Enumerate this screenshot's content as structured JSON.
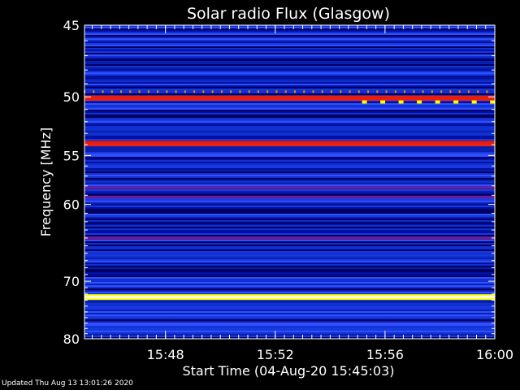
{
  "chart_data": {
    "type": "heatmap",
    "title": "Solar radio Flux (Glasgow)",
    "xlabel": "Start Time (04-Aug-20 15:45:03)",
    "ylabel": "Frequency [MHz]",
    "x_range": [
      "15:45:03",
      "16:00"
    ],
    "x_ticks": [
      "15:48",
      "15:52",
      "15:56",
      "16:00"
    ],
    "y_range": [
      45,
      80
    ],
    "y_ticks": [
      45,
      50,
      55,
      60,
      70,
      80
    ],
    "y_scale": "reciprocal",
    "grid": false,
    "colormap": [
      "#000060",
      "#0010a0",
      "#1030d0",
      "#3050ff",
      "#c00020",
      "#ff2000",
      "#ffff00",
      "#ffffff"
    ],
    "features": [
      {
        "kind": "continuous_band",
        "frequency_mhz": 50.1,
        "width_mhz": 0.4,
        "intensity": "red"
      },
      {
        "kind": "periodic_bursts",
        "frequency_mhz": 49.6,
        "period_s": 20,
        "intensity": "orange"
      },
      {
        "kind": "periodic_bursts",
        "frequency_mhz": 50.4,
        "start_time": "15:55:15",
        "period_s": 40,
        "intensity": "yellow"
      },
      {
        "kind": "continuous_band",
        "frequency_mhz": 53.9,
        "width_mhz": 0.5,
        "intensity": "red"
      },
      {
        "kind": "continuous_band",
        "frequency_mhz": 58.2,
        "width_mhz": 0.3,
        "intensity": "purple"
      },
      {
        "kind": "continuous_band",
        "frequency_mhz": 59.2,
        "width_mhz": 0.3,
        "intensity": "purple"
      },
      {
        "kind": "continuous_band",
        "frequency_mhz": 64.0,
        "width_mhz": 0.4,
        "intensity": "purple"
      },
      {
        "kind": "continuous_band",
        "frequency_mhz": 72.5,
        "width_mhz": 0.4,
        "intensity": "white"
      }
    ]
  },
  "footer": {
    "updated": "Updated Thu Aug 13 13:01:26 2020"
  }
}
